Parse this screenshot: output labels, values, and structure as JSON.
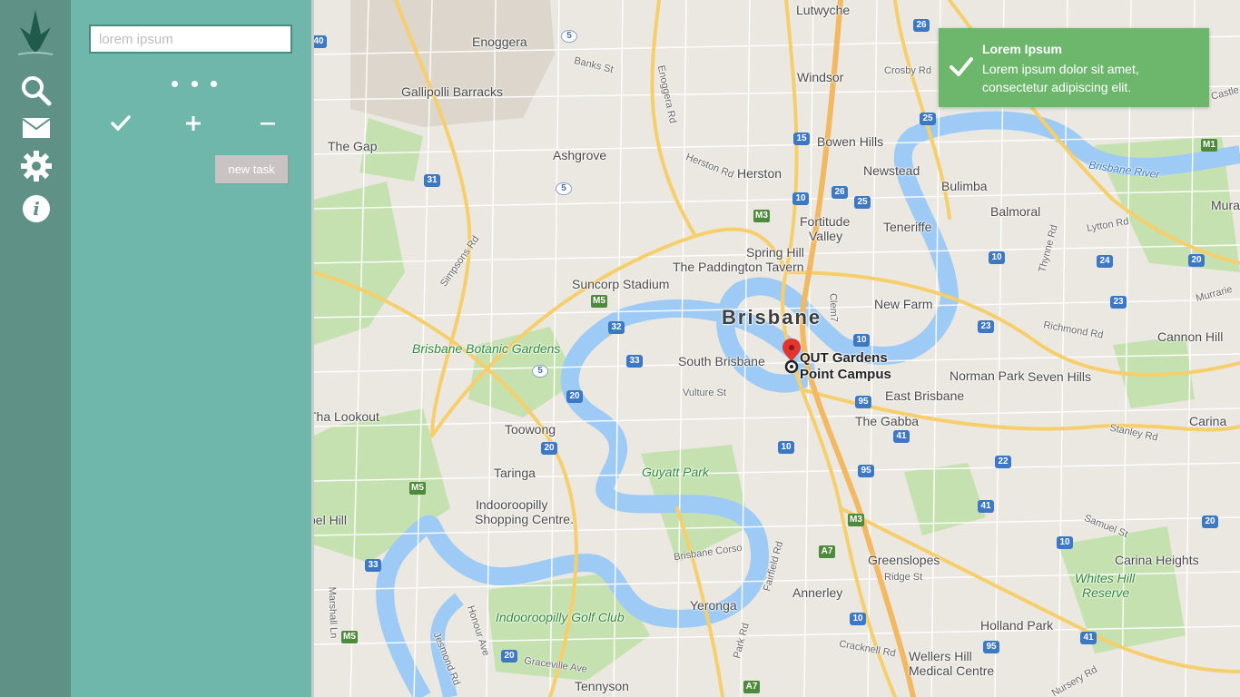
{
  "sidebar": {
    "items": [
      {
        "name": "search",
        "icon": "search-icon"
      },
      {
        "name": "mail",
        "icon": "mail-icon"
      },
      {
        "name": "settings",
        "icon": "gear-icon"
      },
      {
        "name": "info",
        "icon": "info-icon"
      }
    ],
    "logo_icon": "tree-logo-icon"
  },
  "panel": {
    "search_placeholder": "lorem ipsum",
    "actions": [
      {
        "name": "complete",
        "icon": "check-icon"
      },
      {
        "name": "add",
        "icon": "plus-icon"
      },
      {
        "name": "remove",
        "icon": "minus-icon"
      }
    ],
    "new_task_label": "new task"
  },
  "notification": {
    "title": "Lorem Ipsum",
    "body": "Lorem ipsum dolor sit amet, consectetur adipiscing elit.",
    "icon": "check-icon"
  },
  "map": {
    "city": "Brisbane",
    "marker_label_line1": "QUT Gardens",
    "marker_label_line2": "Point Campus",
    "places": [
      "Lutwyche",
      "Enoggera",
      "Gallipolli Barracks",
      "Windsor",
      "Crosby Rd",
      "Bowen Hills",
      "The Gap",
      "Ashgrove",
      "Herston",
      "Newstead",
      "Bulimba",
      "Balmoral",
      "Fortitude",
      "Valley",
      "Teneriffe",
      "Spring Hill",
      "The Paddington Tavern",
      "Suncorp Stadium",
      "New Farm",
      "Brisbane Botanic Gardens",
      "South Brisbane",
      "Norman Park",
      "Seven Hills",
      "Cannon Hill",
      "Tha Lookout",
      "Toowong",
      "East Brisbane",
      "The Gabba",
      "Carina",
      "Taringa",
      "Guyatt Park",
      "Indooroopilly",
      "Shopping Centre.",
      "bel Hill",
      "Greenslopes",
      "Carina Heights",
      "Whites Hill",
      "Reserve",
      "Annerley",
      "Yeronga",
      "Indooroopilly Golf Club",
      "Holland Park",
      "Wellers Hill",
      "Medical Centre",
      "Tennyson",
      "Brisbane River",
      "Mura",
      "Ridge St",
      "Brisbane Corso",
      "Vulture St",
      "Graceville Ave",
      "Honour Ave",
      "Fairfield Rd",
      "Park Rd",
      "Cracknell Rd",
      "Stanley Rd",
      "Richmond Rd",
      "Lytton Rd",
      "Thynne Rd",
      "Enoggera Rd",
      "Herston Rd",
      "Banks St",
      "Simpsons Rd",
      "Clem7",
      "Jesmond Rd",
      "Marshall Ln",
      "Samuel St",
      "Nursery Rd",
      "Murrarie",
      "Castle"
    ],
    "route_shields": [
      "40",
      "5",
      "26",
      "15",
      "10",
      "26",
      "25",
      "M3",
      "31",
      "5",
      "M5",
      "32",
      "33",
      "5",
      "20",
      "20",
      "M5",
      "33",
      "M5",
      "20",
      "10",
      "95",
      "41",
      "95",
      "M3",
      "A7",
      "10",
      "A7",
      "10",
      "95",
      "41",
      "22",
      "41",
      "20",
      "10",
      "24",
      "20",
      "23",
      "23",
      "M1",
      "25",
      "10"
    ]
  }
}
